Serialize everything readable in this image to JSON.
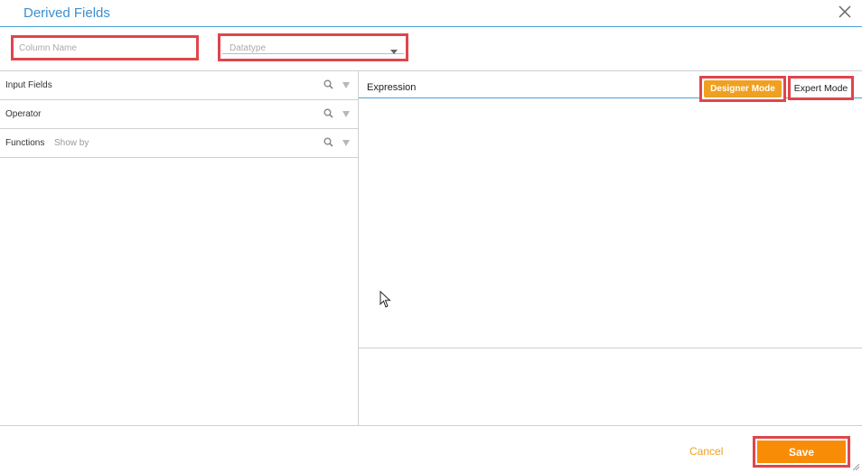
{
  "dialog": {
    "title": "Derived Fields"
  },
  "form": {
    "column_name_placeholder": "Column Name",
    "datatype_placeholder": "Datatype"
  },
  "left_panel": {
    "rows": [
      {
        "label": "Input Fields",
        "sub": ""
      },
      {
        "label": "Operator",
        "sub": ""
      },
      {
        "label": "Functions",
        "sub": "Show by"
      }
    ]
  },
  "expression": {
    "label": "Expression",
    "designer_mode": "Designer Mode",
    "expert_mode": "Expert Mode"
  },
  "footer": {
    "cancel": "Cancel",
    "save": "Save"
  },
  "colors": {
    "accent_blue": "#3a8fd0",
    "orange": "#f0a020",
    "save_orange": "#f98c06",
    "highlight_red": "#e0454d"
  }
}
